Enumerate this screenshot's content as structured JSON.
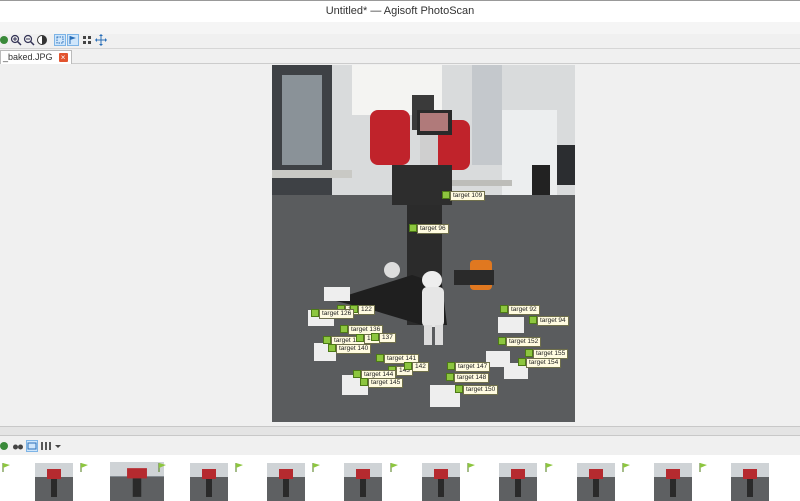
{
  "window": {
    "title": "Untitled* — Agisoft PhotoScan"
  },
  "toolbar": {
    "buttons": [
      {
        "name": "navigation-tool-button",
        "icon": "navigation-icon"
      },
      {
        "name": "zoom-in-button",
        "icon": "zoom-in-icon"
      },
      {
        "name": "zoom-out-button",
        "icon": "zoom-out-icon"
      },
      {
        "name": "brightness-button",
        "icon": "contrast-icon"
      },
      {
        "name": "selection-tool-button",
        "icon": "selection-icon"
      },
      {
        "name": "markers-tool-button",
        "icon": "flag-icon"
      },
      {
        "name": "grid-button",
        "icon": "grid-icon"
      },
      {
        "name": "move-button",
        "icon": "move-icon"
      }
    ]
  },
  "tab": {
    "label": "_baked.JPG",
    "close_icon": "close-icon"
  },
  "markers": [
    {
      "label": "target 109"
    },
    {
      "label": "target 96"
    },
    {
      "label": "123"
    },
    {
      "label": "122"
    },
    {
      "label": "target 126"
    },
    {
      "label": "target 136"
    },
    {
      "label": "target 139"
    },
    {
      "label": "138"
    },
    {
      "label": "137"
    },
    {
      "label": "target 140"
    },
    {
      "label": "target 92"
    },
    {
      "label": "target 94"
    },
    {
      "label": "target 152"
    },
    {
      "label": "target 155"
    },
    {
      "label": "target 154"
    },
    {
      "label": "target 141"
    },
    {
      "label": "143"
    },
    {
      "label": "142"
    },
    {
      "label": "target 144"
    },
    {
      "label": "target 145"
    },
    {
      "label": "target 147"
    },
    {
      "label": "target 148"
    },
    {
      "label": "target 150"
    }
  ],
  "photos_pane": {
    "thumbnail_count": 10,
    "selected_index": 1
  },
  "colors": {
    "flag": "#8dc63f",
    "selection": "#a8d2f2",
    "tab_close": "#e2542f"
  }
}
